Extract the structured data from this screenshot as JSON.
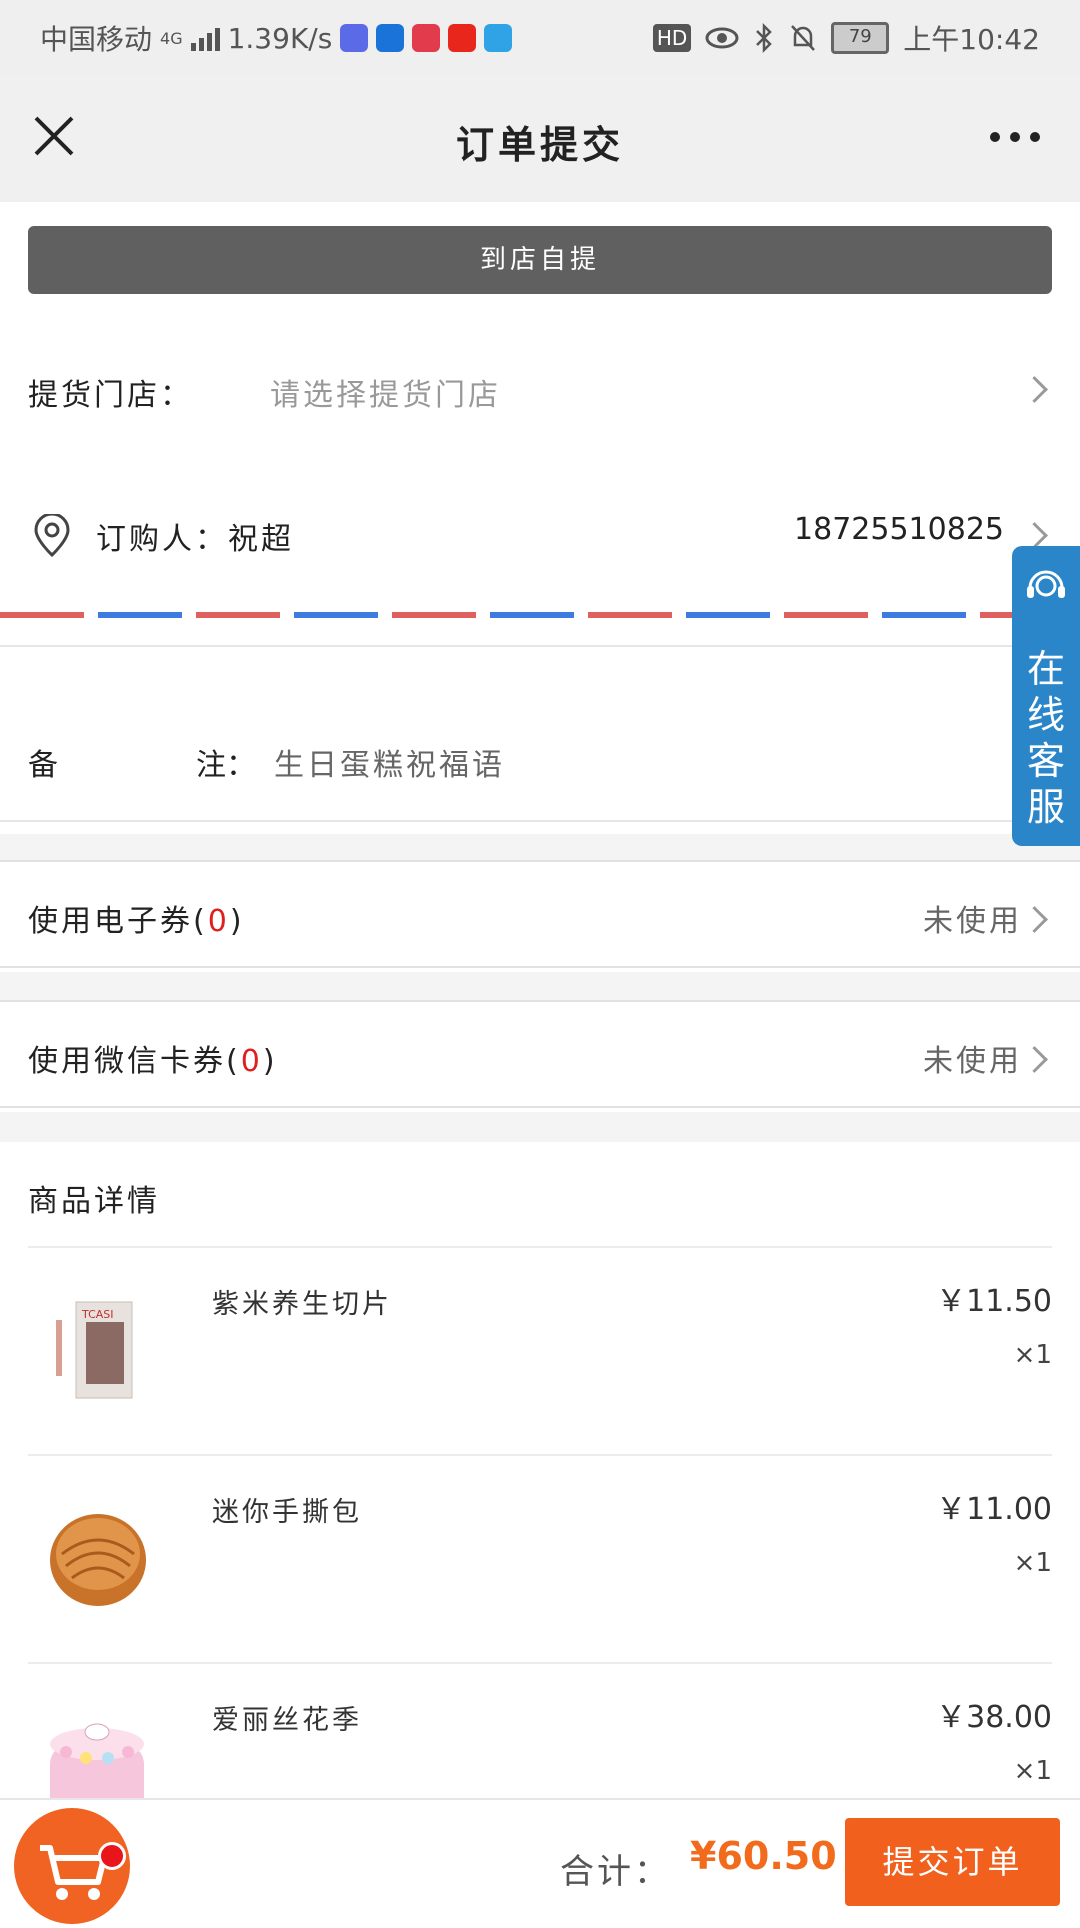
{
  "status_bar": {
    "carrier": "中国移动",
    "network": "4G",
    "speed": "1.39K/s",
    "battery": "79",
    "time": "上午10:42",
    "hd": "HD"
  },
  "header": {
    "title": "订单提交",
    "close_icon": "close-icon",
    "more_icon": "more-icon"
  },
  "delivery": {
    "mode_label": "到店自提"
  },
  "pickup_store": {
    "label": "提货门店：",
    "placeholder": "请选择提货门店"
  },
  "buyer": {
    "label": "订购人：祝超",
    "phone": "18725510825"
  },
  "note": {
    "label_left": "备",
    "label_right": "注：",
    "value": "生日蛋糕祝福语"
  },
  "coupons": [
    {
      "label": "使用电子券(",
      "count": "0",
      "close": ")",
      "status": "未使用"
    },
    {
      "label": "使用微信卡券(",
      "count": "0",
      "close": ")",
      "status": "未使用"
    }
  ],
  "goods": {
    "header": "商品详情",
    "items": [
      {
        "name": "紫米养生切片",
        "price": "￥11.50",
        "qty": "×1"
      },
      {
        "name": "迷你手撕包",
        "price": "￥11.00",
        "qty": "×1"
      },
      {
        "name": "爱丽丝花季",
        "price": "￥38.00",
        "qty": "×1"
      }
    ]
  },
  "customer_service": {
    "label": "在线客服"
  },
  "footer": {
    "total_label": "合计：",
    "total_value": "¥60.50",
    "submit_label": "提交订单"
  },
  "colors": {
    "accent": "#f2601d",
    "price": "#f26a1b",
    "service_tab": "#2b86c9",
    "pickup_button": "#606060"
  }
}
